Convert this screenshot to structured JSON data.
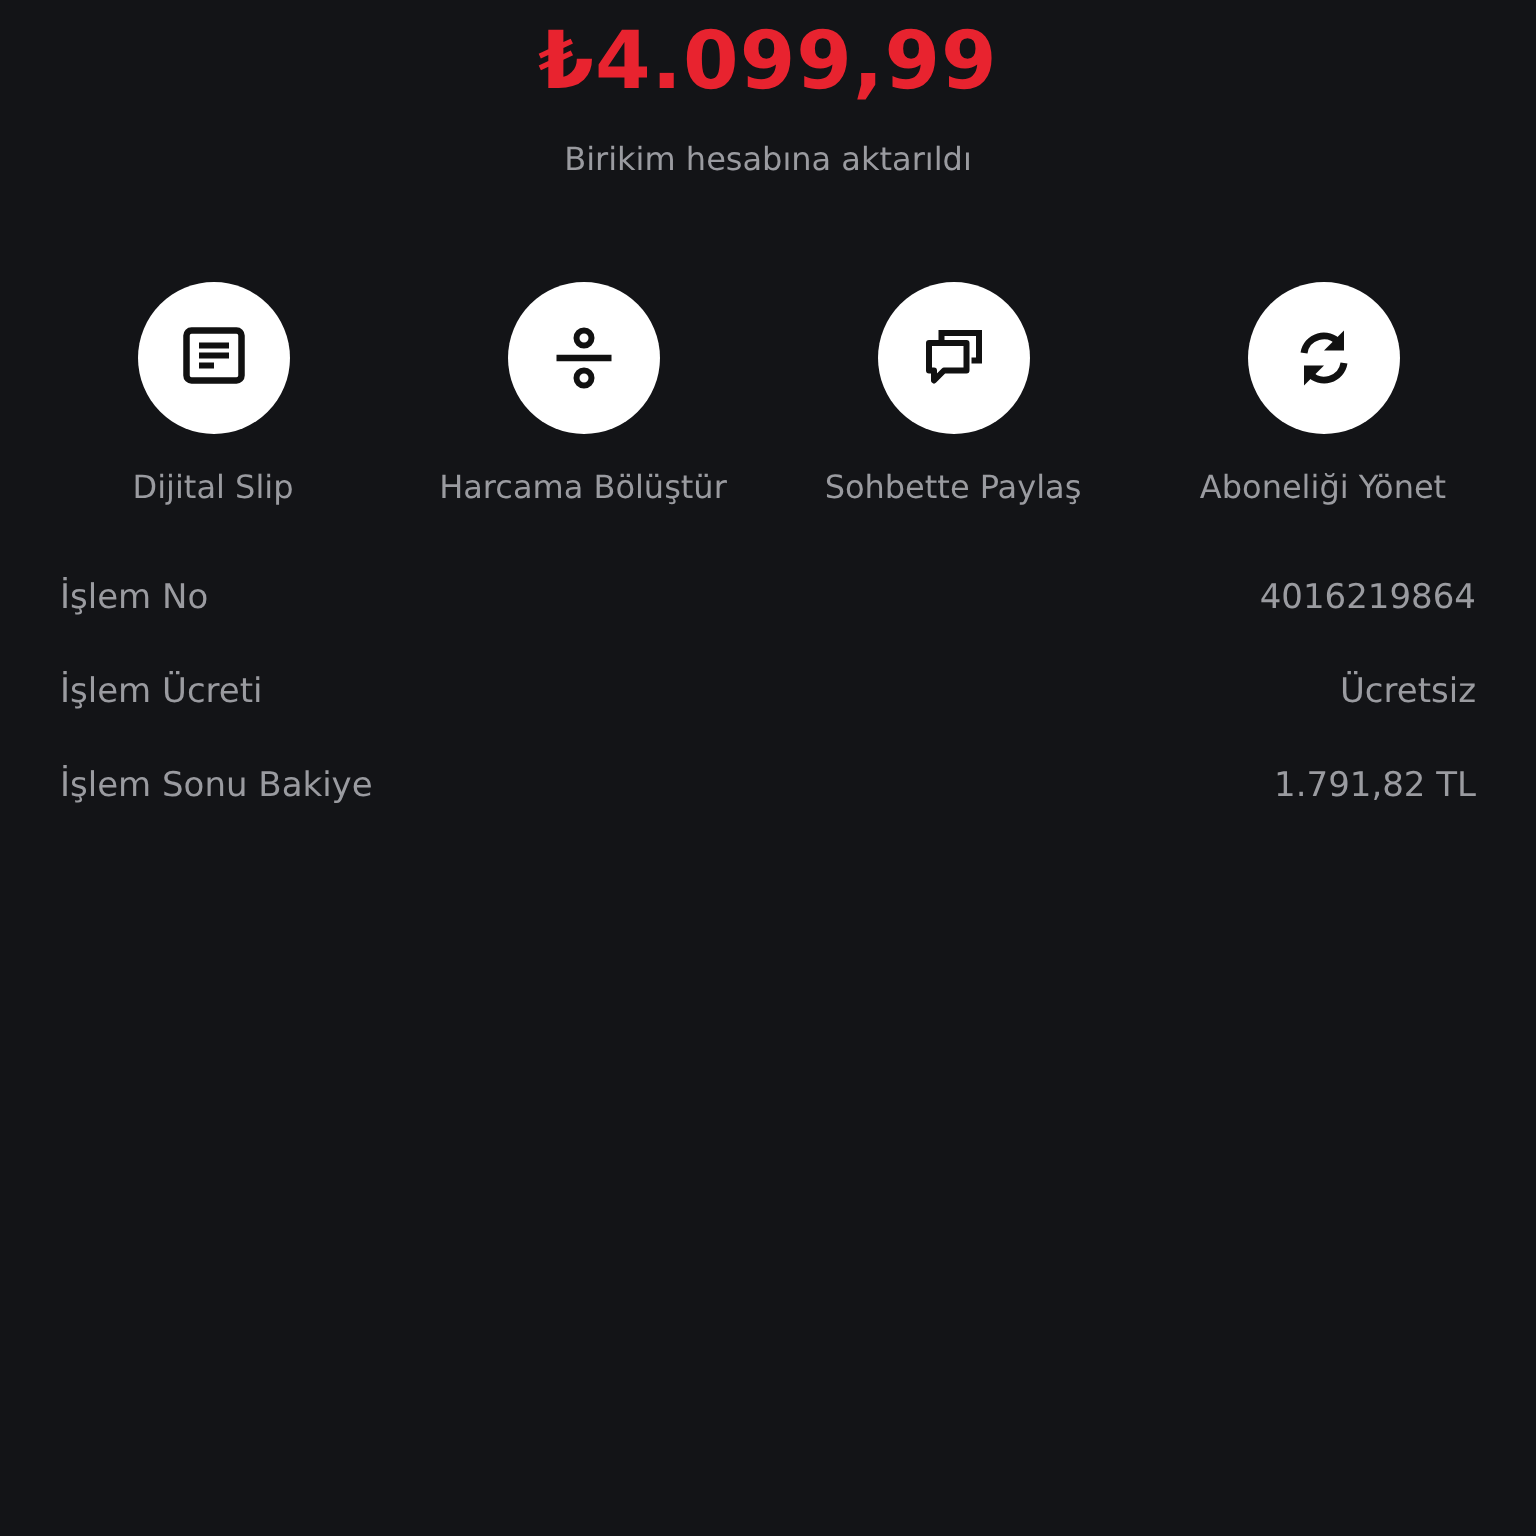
{
  "amount": "₺4.099,99",
  "subtitle": "Birikim hesabına aktarıldı",
  "actions": [
    {
      "kind": "slip",
      "label": "Dijital Slip"
    },
    {
      "kind": "split",
      "label": "Harcama Bölüştür"
    },
    {
      "kind": "chat",
      "label": "Sohbette Paylaş"
    },
    {
      "kind": "sync",
      "label": "Aboneliği Yönet"
    }
  ],
  "details": [
    {
      "label": "İşlem No",
      "value": "4016219864"
    },
    {
      "label": "İşlem Ücreti",
      "value": "Ücretsiz"
    },
    {
      "label": "İşlem Sonu Bakiye",
      "value": "1.791,82 TL"
    }
  ]
}
